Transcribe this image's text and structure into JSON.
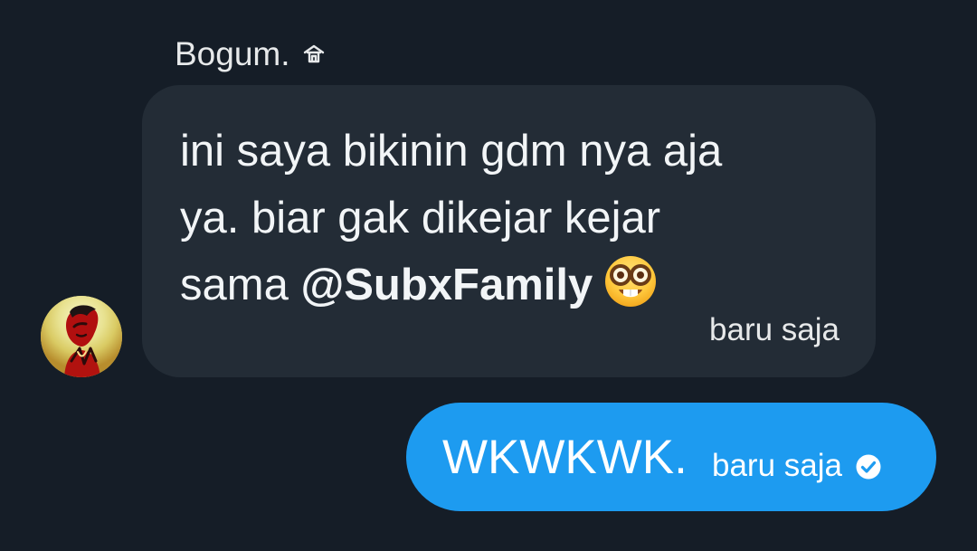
{
  "conversation": {
    "incoming": {
      "sender_name": "Bogum.",
      "sender_badge_icon": "house-badge-icon",
      "message_line_1": "ini saya bikinin gdm nya aja",
      "message_line_2": "ya. biar gak dikejar kejar",
      "message_line_3_prefix": "sama ",
      "mention": "@SubxFamily",
      "emoji_icon": "nerd-face-emoji",
      "timestamp": "baru saja"
    },
    "outgoing": {
      "message": "WKWKWK.",
      "timestamp": "baru saja",
      "status_icon": "sent-check-icon"
    }
  },
  "colors": {
    "background": "#151d27",
    "incoming_bubble": "#232c36",
    "outgoing_bubble": "#1d9bf0",
    "text_primary": "#f2f5f7"
  }
}
